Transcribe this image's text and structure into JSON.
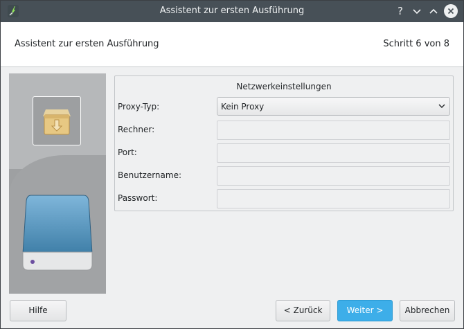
{
  "window": {
    "title": "Assistent zur ersten Ausführung"
  },
  "titlebar_buttons": {
    "help": "?",
    "minimize": "⌄",
    "maximize": "⌃",
    "close": "✕"
  },
  "header": {
    "title": "Assistent zur ersten Ausführung",
    "step": "Schritt 6 von 8"
  },
  "network_settings": {
    "title": "Netzwerkeinstellungen",
    "fields": [
      {
        "label": "Proxy-Typ:",
        "value": "Kein Proxy",
        "type": "select"
      },
      {
        "label": "Rechner:",
        "value": "",
        "type": "text"
      },
      {
        "label": "Port:",
        "value": "",
        "type": "text"
      },
      {
        "label": "Benutzername:",
        "value": "",
        "type": "text"
      },
      {
        "label": "Passwort:",
        "value": "",
        "type": "password"
      }
    ]
  },
  "buttons": {
    "help": "Hilfe",
    "back": "< Zurück",
    "next": "Weiter >",
    "cancel": "Abbrechen"
  },
  "colors": {
    "accent": "#3daee9",
    "titlebar": "#475057",
    "background": "#eff0f1"
  }
}
